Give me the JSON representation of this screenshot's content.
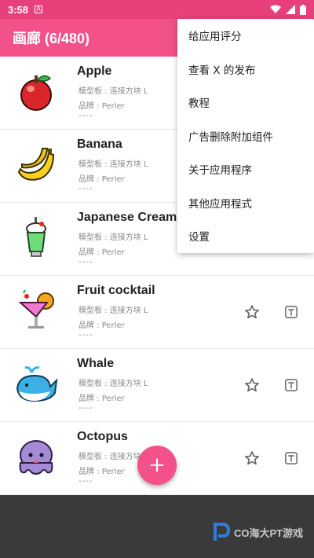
{
  "status_bar": {
    "time": "3:58",
    "notification_glyph": "A"
  },
  "app_bar": {
    "title": "画廊 (6/480)"
  },
  "items": [
    {
      "name": "Apple",
      "board": "模型板 : 连接方块 L",
      "brand": "品牌 : Perler",
      "extra": "----",
      "icon": "pixel-apple"
    },
    {
      "name": "Banana",
      "board": "模型板 : 连接方块 L",
      "brand": "品牌 : Perler",
      "extra": "----",
      "icon": "pixel-banana"
    },
    {
      "name": "Japanese Cream S",
      "board": "模型板 : 连接方块 L",
      "brand": "品牌 : Perler",
      "extra": "----",
      "icon": "pixel-cream-soda"
    },
    {
      "name": "Fruit cocktail",
      "board": "模型板 : 连接方块 L",
      "brand": "品牌 : Perler",
      "extra": "----",
      "icon": "pixel-cocktail"
    },
    {
      "name": "Whale",
      "board": "模型板 : 连接方块 L",
      "brand": "品牌 : Perler",
      "extra": "----",
      "icon": "pixel-whale"
    },
    {
      "name": "Octopus",
      "board": "模型板 : 连接方块",
      "brand": "品牌 : Perler",
      "extra": "----",
      "icon": "pixel-octopus"
    }
  ],
  "menu": {
    "items": [
      "给应用评分",
      "查看 X 的发布",
      "教程",
      "广告删除附加组件",
      "关于应用程序",
      "其他应用程式",
      "设置"
    ]
  },
  "fab": {
    "label": "+"
  },
  "watermark": {
    "text": "CO海大PT游戏"
  },
  "colors": {
    "accent": "#f2518a",
    "status_bar": "#e8407a",
    "bottom_area": "#3a3a3a"
  }
}
